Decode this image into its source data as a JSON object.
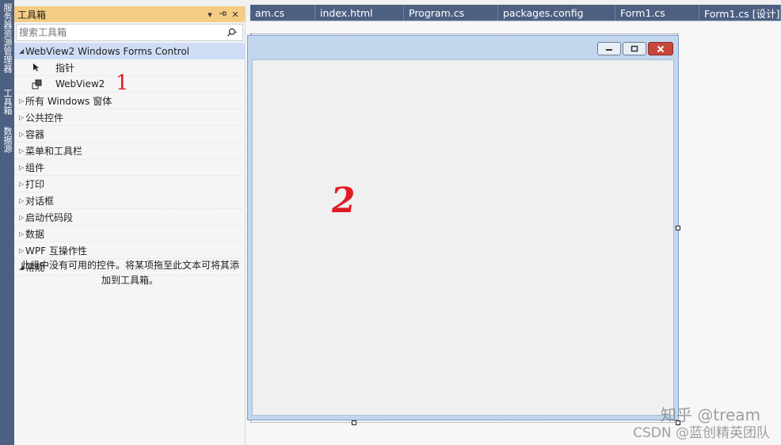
{
  "left_strip": {
    "tabs": [
      "服务器资源管理器",
      "工具箱",
      "数据源"
    ]
  },
  "toolbox": {
    "title": "工具箱",
    "pin": "ᵖ",
    "close": "✕",
    "search": {
      "placeholder": "搜索工具箱",
      "value": ""
    },
    "groups": [
      {
        "label": "WebView2 Windows Forms Control",
        "expanded": true,
        "selected": true
      },
      {
        "label": "所有 Windows 窗体",
        "expanded": false
      },
      {
        "label": "公共控件",
        "expanded": false
      },
      {
        "label": "容器",
        "expanded": false
      },
      {
        "label": "菜单和工具栏",
        "expanded": false
      },
      {
        "label": "组件",
        "expanded": false
      },
      {
        "label": "打印",
        "expanded": false
      },
      {
        "label": "对话框",
        "expanded": false
      },
      {
        "label": "启动代码段",
        "expanded": false
      },
      {
        "label": "数据",
        "expanded": false
      },
      {
        "label": "WPF 互操作性",
        "expanded": false
      },
      {
        "label": "常规",
        "expanded": true
      }
    ],
    "items": [
      {
        "label": "指针",
        "icon": "pointer-icon"
      },
      {
        "label": "WebView2",
        "icon": "webview2-component-icon"
      }
    ],
    "empty_message": "此组中没有可用的控件。将某项拖至此文本可将其添加到工具箱。"
  },
  "tabs": [
    {
      "label": "am.cs"
    },
    {
      "label": "index.html"
    },
    {
      "label": "Program.cs"
    },
    {
      "label": "packages.config"
    },
    {
      "label": "Form1.cs"
    },
    {
      "label": "Form1.cs [设计]"
    }
  ],
  "annotations": {
    "one": "1",
    "two": "2"
  },
  "watermarks": {
    "line1": "知乎 @tream",
    "line2": "CSDN @蓝创精英团队"
  },
  "colors": {
    "accent_title": "#f5cc84",
    "strip": "#4d6082",
    "selection": "#cfdcf5"
  }
}
